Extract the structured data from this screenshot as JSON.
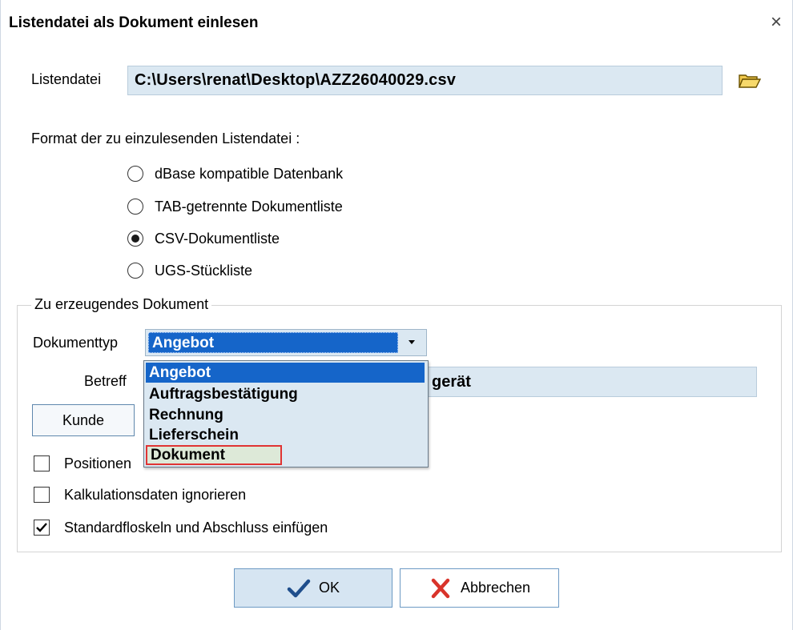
{
  "window": {
    "title": "Listendatei als Dokument einlesen",
    "close_symbol": "×"
  },
  "listendatei": {
    "label": "Listendatei",
    "value": "C:\\Users\\renat\\Desktop\\AZZ26040029.csv",
    "browse_icon": "folder-open-icon"
  },
  "format": {
    "label": "Format der zu einzulesenden Listendatei :",
    "options": [
      {
        "label": "dBase kompatible Datenbank",
        "checked": false
      },
      {
        "label": "TAB-getrennte Dokumentliste",
        "checked": false
      },
      {
        "label": "CSV-Dokumentliste",
        "checked": true
      },
      {
        "label": "UGS-Stückliste",
        "checked": false
      }
    ]
  },
  "document_group": {
    "legend": "Zu erzeugendes Dokument",
    "dokumenttyp_label": "Dokumenttyp",
    "dokumenttyp_value": "Angebot",
    "dropdown_open": true,
    "dropdown_options": [
      "Angebot",
      "Auftragsbestätigung",
      "Rechnung",
      "Lieferschein",
      "Dokument"
    ],
    "dropdown_selected": "Angebot",
    "dropdown_hover": "Dokument",
    "betreff_label": "Betreff",
    "betreff_visible_value": "gerät",
    "kunde_button": "Kunde",
    "checkboxes": [
      {
        "label": "Positionen neu nummerieren",
        "visible_label": "Positionen",
        "checked": false
      },
      {
        "label": "Kalkulationsdaten ignorieren",
        "checked": false
      },
      {
        "label": "Standardfloskeln und Abschluss einfügen",
        "checked": true
      }
    ]
  },
  "buttons": {
    "ok": "OK",
    "cancel": "Abbrechen"
  },
  "colors": {
    "field_bg": "#dbe8f2",
    "selection": "#1565c9",
    "hover_border": "#e03434",
    "ok_check": "#1f4e8c",
    "cancel_x": "#d9342b"
  }
}
